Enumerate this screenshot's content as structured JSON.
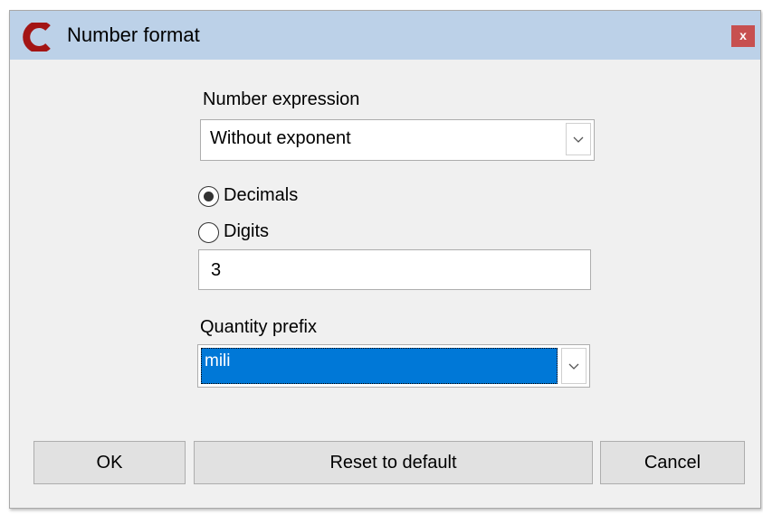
{
  "window": {
    "title": "Number format",
    "icon": "app-c-logo",
    "close_label": "x",
    "close_color": "#c75050",
    "titlebar_color": "#bcd1e8"
  },
  "number_expression": {
    "label": "Number expression",
    "selected": "Without exponent"
  },
  "mode": {
    "decimals_label": "Decimals",
    "digits_label": "Digits",
    "selected": "Decimals",
    "value": "3"
  },
  "quantity_prefix": {
    "label": "Quantity prefix",
    "selected": "mili",
    "highlight_color": "#0078d7"
  },
  "buttons": {
    "ok": "OK",
    "reset": "Reset to default",
    "cancel": "Cancel"
  }
}
